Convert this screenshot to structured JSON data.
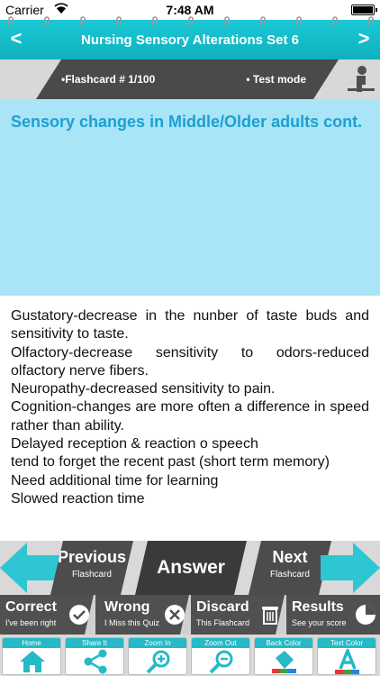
{
  "status": {
    "carrier": "Carrier",
    "time": "7:48 AM"
  },
  "header": {
    "title": "Nursing Sensory Alterations Set 6",
    "prev_label": "<",
    "next_label": ">"
  },
  "info": {
    "flashcard_label": "•Flashcard #  1/100",
    "mode_label": "• Test mode"
  },
  "question": {
    "text": "Sensory changes in Middle/Older adults cont."
  },
  "answer_lines": [
    "Gustatory-decrease in the nunber of taste buds and sensitivity to taste.",
    "Olfactory-decrease sensitivity to odors-reduced olfactory nerve fibers.",
    "Neuropathy-decreased sensitivity to pain.",
    "Cognition-changes are more often a difference in speed rather than ability.",
    "Delayed reception & reaction o speech",
    "tend to forget the recent past (short term memory)",
    "Need additional time for learning",
    "Slowed reaction time"
  ],
  "nav": {
    "previous": {
      "label": "Previous",
      "sub": "Flashcard"
    },
    "answer": {
      "label": "Answer"
    },
    "next": {
      "label": "Next",
      "sub": "Flashcard"
    }
  },
  "actions": {
    "correct": {
      "label": "Correct",
      "sub": "I've been right",
      "icon": "check-icon"
    },
    "wrong": {
      "label": "Wrong",
      "sub": "I Miss this Quiz",
      "icon": "x-icon"
    },
    "discard": {
      "label": "Discard",
      "sub": "This Flashcard",
      "icon": "trash-icon"
    },
    "results": {
      "label": "Results",
      "sub": "See your score",
      "icon": "pie-chart-icon"
    }
  },
  "toolbar": {
    "home": "Home",
    "share": "Share It",
    "zoom_in": "Zoom In",
    "zoom_out": "Zoom Out",
    "back_color": "Back Color",
    "text_color": "Text Color"
  },
  "colors": {
    "accent": "#1bc9d6",
    "question_bg": "#a9e4f7",
    "question_text": "#1ba1d0",
    "dark": "#4a4a4a"
  }
}
